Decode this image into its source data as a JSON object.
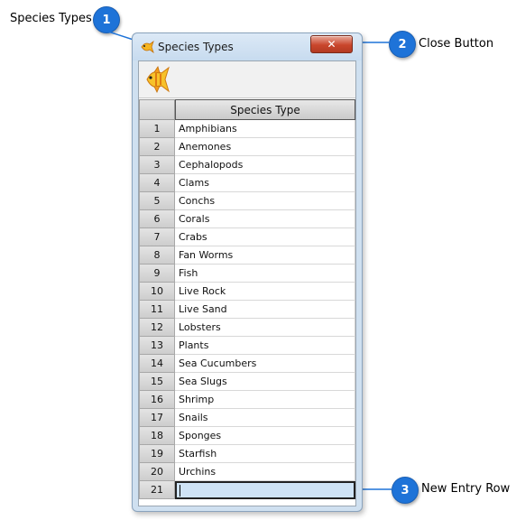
{
  "callouts": {
    "c1": {
      "number": "1",
      "label": "Species Types"
    },
    "c2": {
      "number": "2",
      "label": "Close Button"
    },
    "c3": {
      "number": "3",
      "label": "New Entry Row"
    }
  },
  "window": {
    "title": "Species Types",
    "close_glyph": "✕"
  },
  "grid": {
    "column_header": "Species Type",
    "rows": [
      {
        "num": "1",
        "value": "Amphibians"
      },
      {
        "num": "2",
        "value": "Anemones"
      },
      {
        "num": "3",
        "value": "Cephalopods"
      },
      {
        "num": "4",
        "value": "Clams"
      },
      {
        "num": "5",
        "value": "Conchs"
      },
      {
        "num": "6",
        "value": "Corals"
      },
      {
        "num": "7",
        "value": "Crabs"
      },
      {
        "num": "8",
        "value": "Fan Worms"
      },
      {
        "num": "9",
        "value": "Fish"
      },
      {
        "num": "10",
        "value": "Live Rock"
      },
      {
        "num": "11",
        "value": "Live Sand"
      },
      {
        "num": "12",
        "value": "Lobsters"
      },
      {
        "num": "13",
        "value": "Plants"
      },
      {
        "num": "14",
        "value": "Sea Cucumbers"
      },
      {
        "num": "15",
        "value": "Sea Slugs"
      },
      {
        "num": "16",
        "value": "Shrimp"
      },
      {
        "num": "17",
        "value": "Snails"
      },
      {
        "num": "18",
        "value": "Sponges"
      },
      {
        "num": "19",
        "value": "Starfish"
      },
      {
        "num": "20",
        "value": "Urchins"
      }
    ],
    "new_row": {
      "num": "21",
      "value": ""
    }
  },
  "icons": {
    "title": "fish-icon",
    "toolbar": "fish-icon",
    "close": "close-icon"
  },
  "colors": {
    "badge": "#1e73d8",
    "window_frame": "#cfe0f0",
    "close_button": "#c9462c",
    "new_row": "#cfe3f5"
  }
}
